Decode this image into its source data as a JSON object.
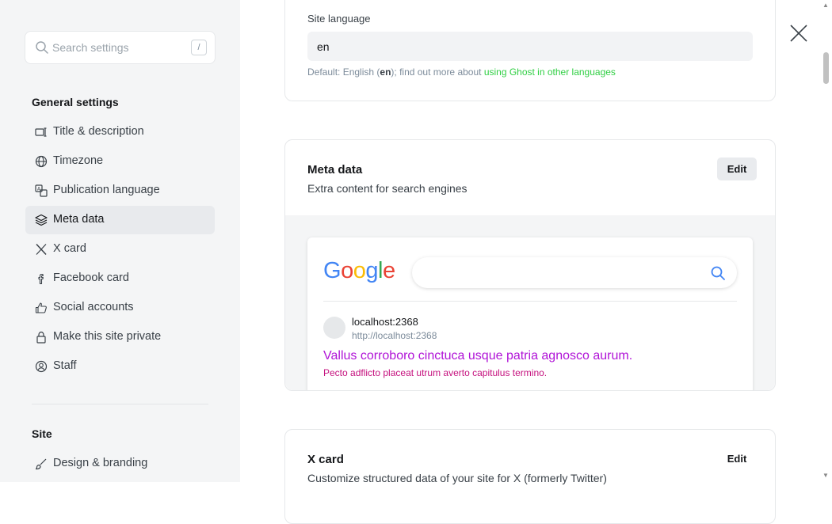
{
  "search": {
    "placeholder": "Search settings",
    "shortcut": "/"
  },
  "sidebar": {
    "general_title": "General settings",
    "items": [
      {
        "label": "Title & description",
        "icon": "title-description-icon"
      },
      {
        "label": "Timezone",
        "icon": "globe-icon"
      },
      {
        "label": "Publication language",
        "icon": "translate-icon"
      },
      {
        "label": "Meta data",
        "icon": "layers-icon",
        "active": true
      },
      {
        "label": "X card",
        "icon": "x-logo-icon"
      },
      {
        "label": "Facebook card",
        "icon": "facebook-icon"
      },
      {
        "label": "Social accounts",
        "icon": "thumbs-up-icon"
      },
      {
        "label": "Make this site private",
        "icon": "lock-icon"
      },
      {
        "label": "Staff",
        "icon": "staff-icon"
      }
    ],
    "site_title": "Site",
    "site_items": [
      {
        "label": "Design & branding",
        "icon": "brush-icon"
      }
    ]
  },
  "language_card": {
    "field_label": "Site language",
    "value": "en",
    "hint_prefix": "Default: English (",
    "hint_code": "en",
    "hint_middle": "); find out more about ",
    "hint_link": "using Ghost in other languages"
  },
  "meta_card": {
    "title": "Meta data",
    "subtitle": "Extra content for search engines",
    "edit_label": "Edit",
    "preview": {
      "logo_text": "Google",
      "site_name": "localhost:2368",
      "site_url": "http://localhost:2368",
      "result_title": "Vallus corroboro cinctuca usque patria agnosco aurum.",
      "result_desc": "Pecto adflicto placeat utrum averto capitulus termino."
    }
  },
  "x_card": {
    "title": "X card",
    "subtitle": "Customize structured data of your site for X (formerly Twitter)",
    "edit_label": "Edit"
  },
  "colors": {
    "accent_green": "#30cf43",
    "result_title": "#b013d7",
    "result_desc": "#c5117e"
  }
}
